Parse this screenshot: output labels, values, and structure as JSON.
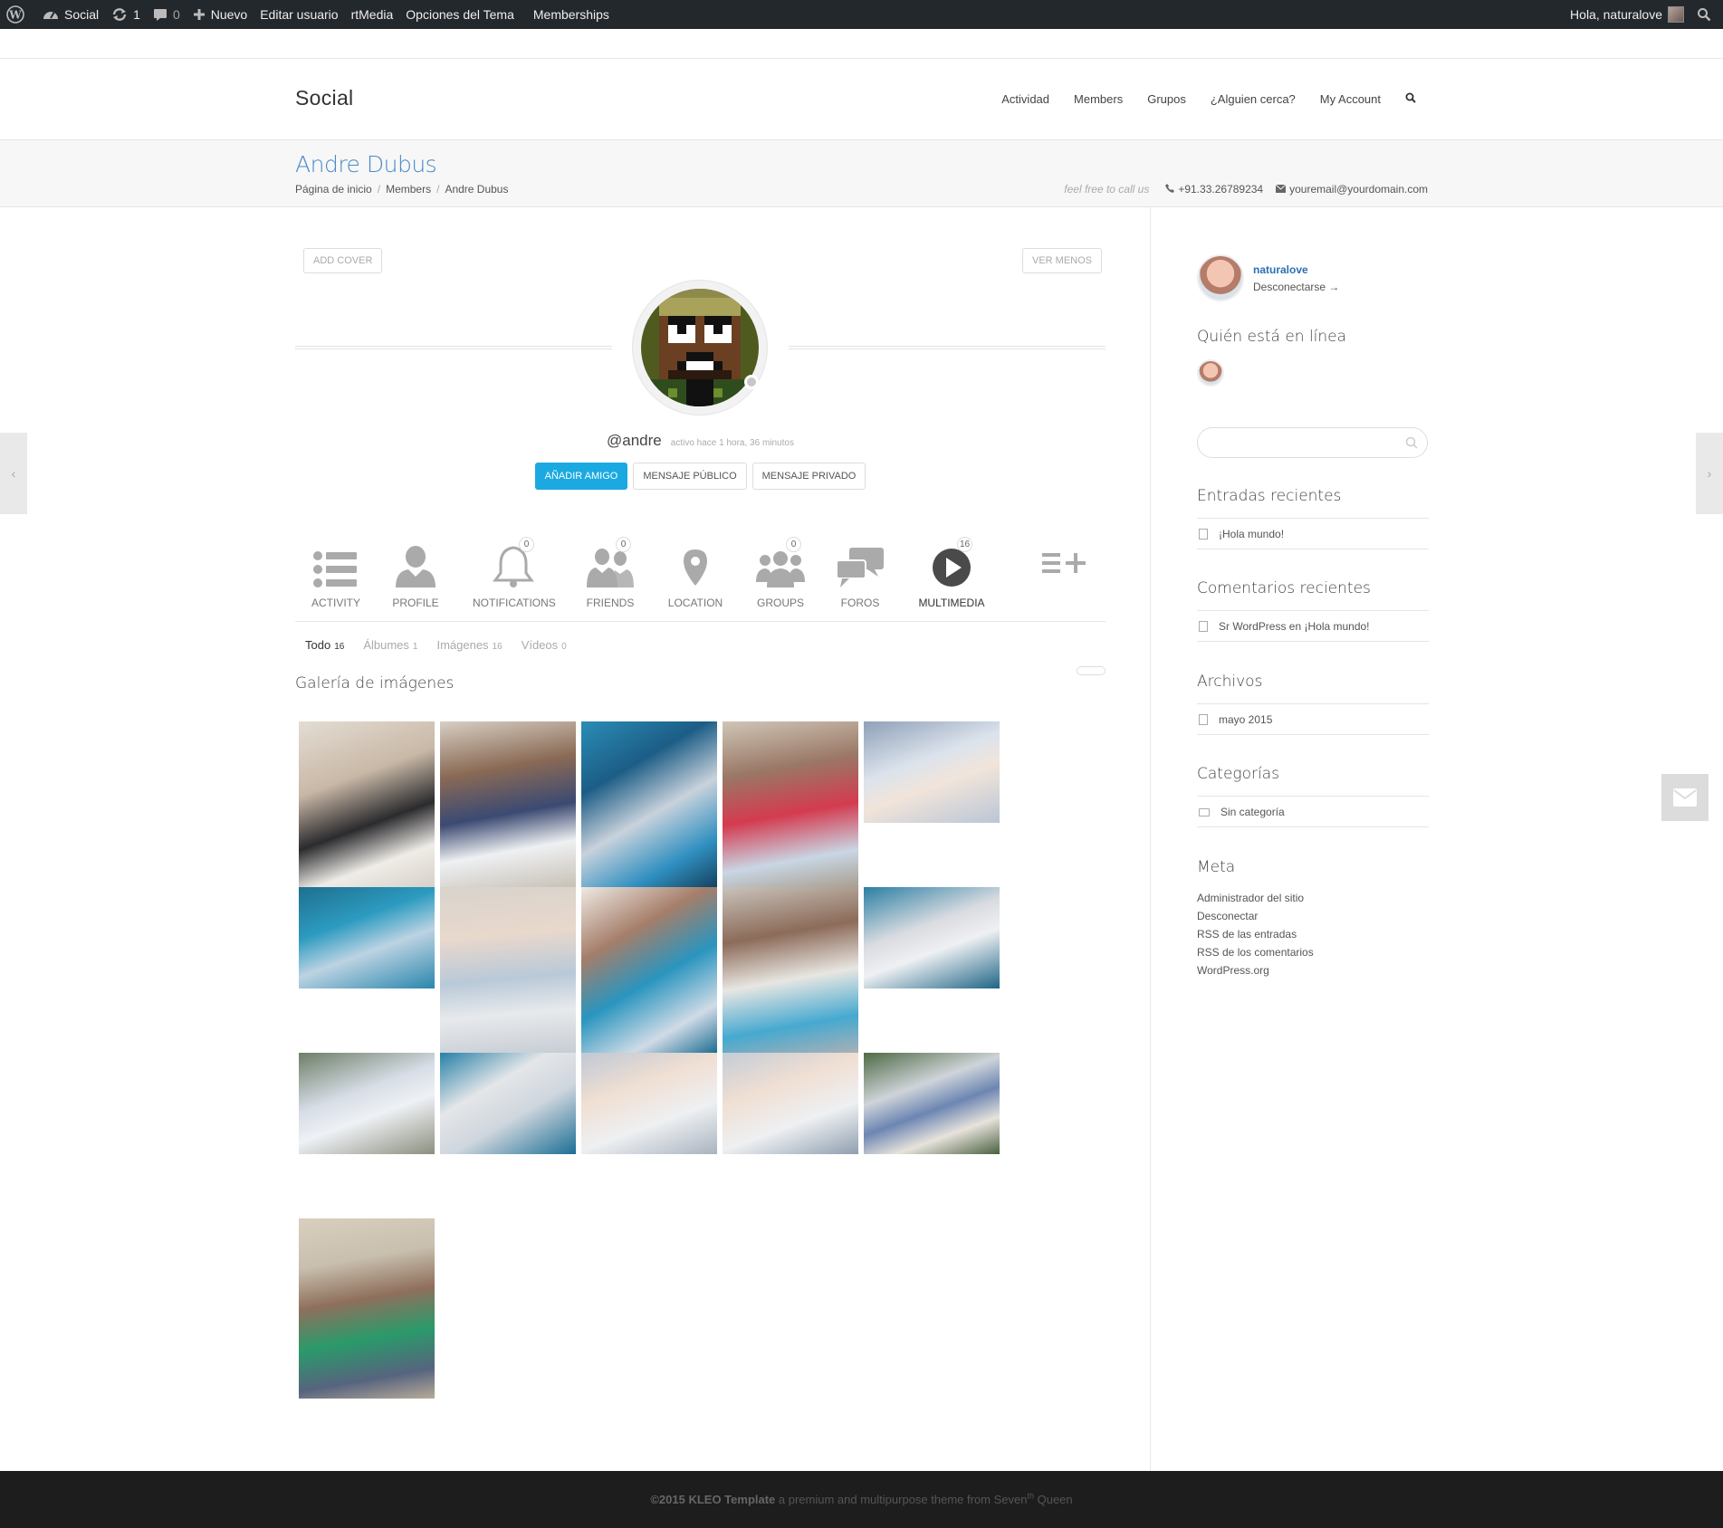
{
  "adminbar": {
    "site": "Social",
    "updates": "1",
    "comments": "0",
    "new": "Nuevo",
    "edit_user": "Editar usuario",
    "rtmedia": "rtMedia",
    "theme_options": "Opciones del Tema",
    "memberships": "Memberships",
    "greeting": "Hola, naturalove"
  },
  "header": {
    "logo": "Social",
    "nav": [
      "Actividad",
      "Members",
      "Grupos",
      "¿Alguien cerca?",
      "My Account"
    ]
  },
  "titlebar": {
    "title": "Andre Dubus",
    "breadcrumb": [
      "Página de inicio",
      "Members",
      "Andre Dubus"
    ],
    "call_text": "feel free to call us",
    "phone": "+91.33.26789234",
    "email": "youremail@yourdomain.com"
  },
  "profile": {
    "add_cover": "ADD COVER",
    "ver_menos": "VER MENOS",
    "handle": "@andre",
    "activity": "activo hace 1 hora, 36 minutos",
    "buttons": {
      "add_friend": "AÑADIR AMIGO",
      "public_msg": "MENSAJE PÚBLICO",
      "private_msg": "MENSAJE PRIVADO"
    },
    "tabs": [
      {
        "label": "ACTIVITY",
        "icon": "list-icon",
        "count": ""
      },
      {
        "label": "PROFILE",
        "icon": "user-icon",
        "count": ""
      },
      {
        "label": "NOTIFICATIONS",
        "icon": "bell-icon",
        "count": "0"
      },
      {
        "label": "FRIENDS",
        "icon": "friends-icon",
        "count": "0"
      },
      {
        "label": "LOCATION",
        "icon": "map-pin-icon",
        "count": ""
      },
      {
        "label": "GROUPS",
        "icon": "group-icon",
        "count": "0"
      },
      {
        "label": "FOROS",
        "icon": "chat-icon",
        "count": ""
      },
      {
        "label": "MULTIMEDIA",
        "icon": "play-icon",
        "count": "16"
      }
    ],
    "subnav": [
      {
        "label": "Todo",
        "count": "16"
      },
      {
        "label": "Álbumes",
        "count": "1"
      },
      {
        "label": "Imágenes",
        "count": "16"
      },
      {
        "label": "Vídeos",
        "count": "0"
      }
    ],
    "gallery_title": "Galería de imágenes"
  },
  "sidebar": {
    "user": "naturalove",
    "logout": "Desconectarse →",
    "online_title": "Quién está en línea",
    "recent_posts_title": "Entradas recientes",
    "recent_post": "¡Hola mundo!",
    "recent_comments_title": "Comentarios recientes",
    "recent_comment": "Sr WordPress en ¡Hola mundo!",
    "archives_title": "Archivos",
    "archive": "mayo 2015",
    "categories_title": "Categorías",
    "category": "Sin categoría",
    "meta_title": "Meta",
    "meta_links": [
      "Administrador del sitio",
      "Desconectar",
      "RSS de las entradas",
      "RSS de los comentarios",
      "WordPress.org"
    ]
  },
  "footer": {
    "brand": "©2015 KLEO Template",
    "text_a": " a premium and multipurpose theme from Seven",
    "sup": "th",
    "text_b": " Queen"
  },
  "colors": {
    "accent": "#1ba9e1",
    "title_blue": "#4a8ac8",
    "adminbar": "#23282d",
    "footer": "#1d1d1d"
  }
}
